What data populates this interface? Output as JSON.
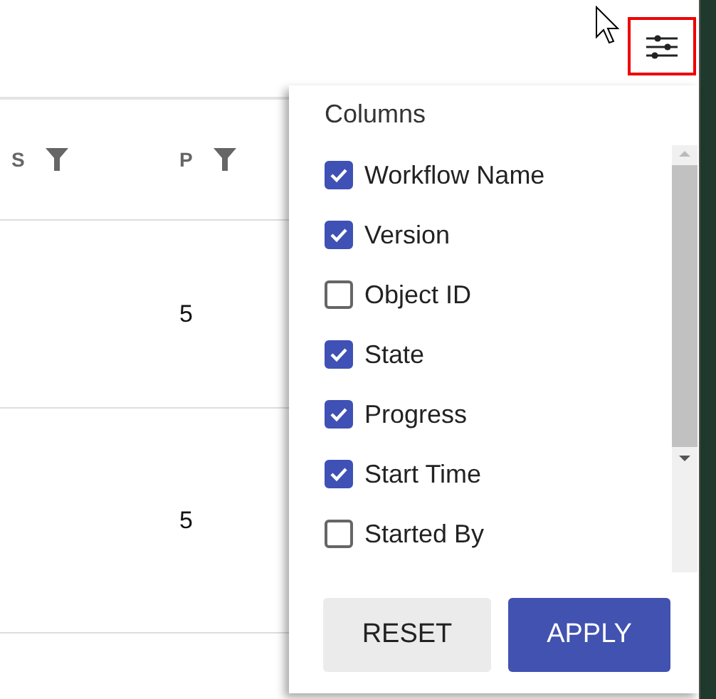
{
  "table": {
    "columns": [
      {
        "label": "S"
      },
      {
        "label": "P"
      }
    ],
    "rows": [
      {
        "cells": [
          "",
          "5"
        ]
      },
      {
        "cells": [
          "",
          "5"
        ]
      }
    ]
  },
  "column_menu": {
    "title": "Columns",
    "options": [
      {
        "label": "Workflow Name",
        "checked": true
      },
      {
        "label": "Version",
        "checked": true
      },
      {
        "label": "Object ID",
        "checked": false
      },
      {
        "label": "State",
        "checked": true
      },
      {
        "label": "Progress",
        "checked": true
      },
      {
        "label": "Start Time",
        "checked": true
      },
      {
        "label": "Started By",
        "checked": false
      }
    ],
    "buttons": [
      {
        "label": "RESET",
        "kind": "secondary"
      },
      {
        "label": "APPLY",
        "kind": "primary"
      }
    ]
  }
}
